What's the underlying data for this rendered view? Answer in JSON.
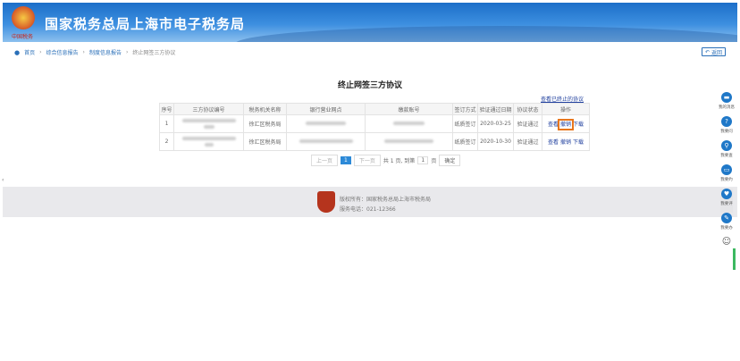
{
  "header": {
    "title": "国家税务总局上海市电子税务局",
    "emblem_text": "中国税务"
  },
  "breadcrumb": [
    "首页",
    "综合信息报告",
    "制度信息报告",
    "终止网签三方协议"
  ],
  "back_label": "返回",
  "page_title": "终止网签三方协议",
  "view_terminated_link": "查看已终止的协议",
  "table": {
    "columns": [
      "序号",
      "三方协议编号",
      "税务机关名称",
      "银行营业网点",
      "缴款账号",
      "签订方式",
      "验证通过日期",
      "协议状态",
      "操作"
    ],
    "rows": [
      {
        "no": "1",
        "tax_office": "徐汇区税务局",
        "sign_method": "纸质签订",
        "date": "2020-03-25",
        "status": "验证通过"
      },
      {
        "no": "2",
        "tax_office": "徐汇区税务局",
        "sign_method": "纸质签订",
        "date": "2020-10-30",
        "status": "验证通过"
      }
    ],
    "actions": [
      "查看",
      "撤销",
      "下载"
    ]
  },
  "pager": {
    "prev": "上一页",
    "current": "1",
    "next": "下一页",
    "total": "共 1 页, 到第",
    "goto_value": "1",
    "page_unit": "页",
    "confirm": "确定"
  },
  "footer": {
    "copyright": "版权所有：国家税务总局上海市税务局",
    "phone": "服务电话：021-12366"
  },
  "side_menu": [
    {
      "icon": "message-icon",
      "label": "我的消息",
      "glyph": "▬"
    },
    {
      "icon": "question-icon",
      "label": "我要问",
      "glyph": "?"
    },
    {
      "icon": "search-icon",
      "label": "我要查",
      "glyph": "⚲"
    },
    {
      "icon": "calendar-icon",
      "label": "我要约",
      "glyph": "▭"
    },
    {
      "icon": "rate-icon",
      "label": "我要评",
      "glyph": "♥"
    },
    {
      "icon": "edit-icon",
      "label": "我要办",
      "glyph": "✎"
    }
  ]
}
